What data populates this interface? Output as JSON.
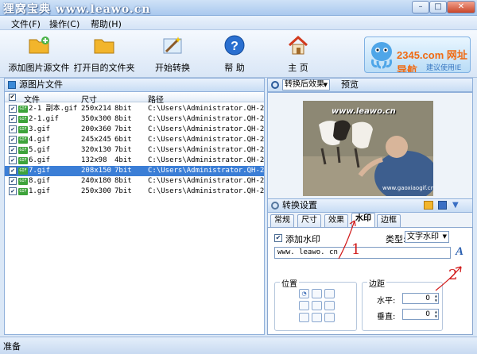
{
  "window": {
    "title": "狸窝宝典 www.leawo.cn"
  },
  "menu": [
    "文件(F)",
    "操作(C)",
    "帮助(H)"
  ],
  "toolbar": {
    "add_source": "添加图片源文件",
    "open_folder": "打开目的文件夹",
    "start_convert": "开始转换",
    "help": "帮 助",
    "home": "主 页"
  },
  "brand": {
    "text": "2345.com 网址导航",
    "top_link": "建议使用IE"
  },
  "source": {
    "title": "源图片文件",
    "columns": [
      "文件",
      "尺寸",
      "路径"
    ],
    "rows": [
      {
        "name": "2-1 副本.gif",
        "size": "250x214",
        "bit": "8bit",
        "path": "C:\\Users\\Administrator.QH-2...",
        "checked": true,
        "selected": false
      },
      {
        "name": "2-1.gif",
        "size": "350x300",
        "bit": "8bit",
        "path": "C:\\Users\\Administrator.QH-2...",
        "checked": true,
        "selected": false
      },
      {
        "name": "3.gif",
        "size": "200x360",
        "bit": "7bit",
        "path": "C:\\Users\\Administrator.QH-2...",
        "checked": true,
        "selected": false
      },
      {
        "name": "4.gif",
        "size": "245x245",
        "bit": "6bit",
        "path": "C:\\Users\\Administrator.QH-2...",
        "checked": true,
        "selected": false
      },
      {
        "name": "5.gif",
        "size": "320x130",
        "bit": "7bit",
        "path": "C:\\Users\\Administrator.QH-2...",
        "checked": true,
        "selected": false
      },
      {
        "name": "6.gif",
        "size": "132x98",
        "bit": "4bit",
        "path": "C:\\Users\\Administrator.QH-2...",
        "checked": true,
        "selected": false
      },
      {
        "name": "7.gif",
        "size": "208x150",
        "bit": "7bit",
        "path": "C:\\Users\\Administrator.QH-2...",
        "checked": true,
        "selected": true
      },
      {
        "name": "8.gif",
        "size": "240x180",
        "bit": "8bit",
        "path": "C:\\Users\\Administrator.QH-2...",
        "checked": true,
        "selected": false
      },
      {
        "name": "1.gif",
        "size": "250x300",
        "bit": "7bit",
        "path": "C:\\Users\\Administrator.QH-2...",
        "checked": true,
        "selected": false
      }
    ]
  },
  "preview": {
    "mode": "转换后效果",
    "label": "预览",
    "watermark_text": "www.leawo.cn",
    "corner_text": "www.gaoxiaogif.cn"
  },
  "settings": {
    "title": "转换设置",
    "tabs": [
      "常规",
      "尺寸",
      "效果",
      "水印",
      "边框"
    ],
    "active_tab": "水印",
    "add_watermark": "添加水印",
    "type_label": "类型:",
    "type_value": "文字水印",
    "watermark_input": "www. leawo. cn",
    "position_label": "位置",
    "margin_label": "边距",
    "horizontal_label": "水平:",
    "horizontal_value": "0",
    "vertical_label": "垂直:",
    "vertical_value": "0"
  },
  "annotations": {
    "n1": "1",
    "n2": "2"
  },
  "status": "准备",
  "colors": {
    "accent": "#3b7ed6",
    "annotation": "#d11a1a"
  }
}
